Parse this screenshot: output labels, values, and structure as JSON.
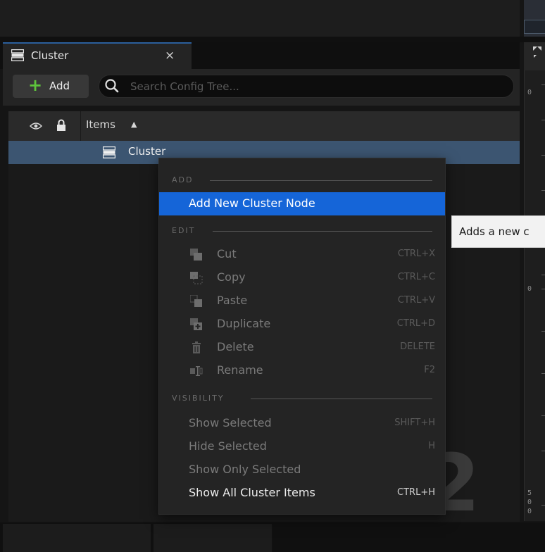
{
  "outliner": {
    "tab_title": "Cluster",
    "close_glyph": "×",
    "add_label": "Add",
    "search_placeholder": "Search Config Tree...",
    "column_items": "Items",
    "sort_glyph": "▲",
    "root_item": "Cluster"
  },
  "context_menu": {
    "section_add": "ADD",
    "section_edit": "EDIT",
    "section_visibility": "VISIBILITY",
    "items": [
      {
        "label": "Add New Cluster Node",
        "shortcut": "",
        "icon": "",
        "state": "highlighted"
      },
      {
        "label": "Cut",
        "shortcut": "CTRL+X",
        "icon": "cut-icon",
        "state": "disabled"
      },
      {
        "label": "Copy",
        "shortcut": "CTRL+C",
        "icon": "copy-icon",
        "state": "disabled"
      },
      {
        "label": "Paste",
        "shortcut": "CTRL+V",
        "icon": "paste-icon",
        "state": "disabled"
      },
      {
        "label": "Duplicate",
        "shortcut": "CTRL+D",
        "icon": "duplicate-icon",
        "state": "disabled"
      },
      {
        "label": "Delete",
        "shortcut": "DELETE",
        "icon": "trash-icon",
        "state": "disabled"
      },
      {
        "label": "Rename",
        "shortcut": "F2",
        "icon": "rename-icon",
        "state": "disabled"
      },
      {
        "label": "Show Selected",
        "shortcut": "SHIFT+H",
        "icon": "",
        "state": "disabled"
      },
      {
        "label": "Hide Selected",
        "shortcut": "H",
        "icon": "",
        "state": "disabled"
      },
      {
        "label": "Show Only Selected",
        "shortcut": "",
        "icon": "",
        "state": "disabled"
      },
      {
        "label": "Show All Cluster Items",
        "shortcut": "CTRL+H",
        "icon": "",
        "state": "enabled"
      }
    ]
  },
  "tooltip": {
    "text": "Adds a new c"
  },
  "ruler": {
    "labels": [
      "0",
      "0",
      "5",
      "0",
      "0"
    ]
  },
  "background": {
    "large_number": "2"
  },
  "colors": {
    "highlight": "#1565d8",
    "selection_row": "#3c5571",
    "add_plus": "#5ec43c"
  }
}
